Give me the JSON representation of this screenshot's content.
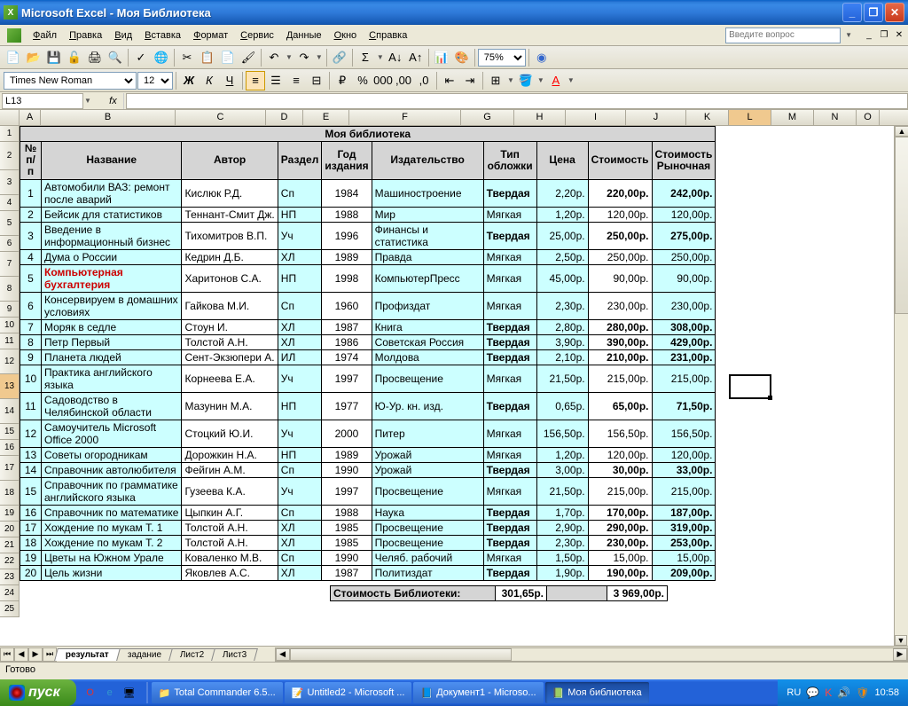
{
  "window": {
    "title": "Microsoft Excel - Моя Библиотека"
  },
  "menu": {
    "items": [
      "Файл",
      "Правка",
      "Вид",
      "Вставка",
      "Формат",
      "Сервис",
      "Данные",
      "Окно",
      "Справка"
    ],
    "question_placeholder": "Введите вопрос"
  },
  "toolbar2": {
    "font": "Times New Roman",
    "size": "12",
    "zoom": "75%"
  },
  "namebox": "L13",
  "cols": {
    "A": 24,
    "B": 152,
    "C": 102,
    "D": 42,
    "E": 52,
    "F": 126,
    "G": 60,
    "H": 58,
    "I": 68,
    "J": 68,
    "K": 48,
    "L": 48,
    "M": 48,
    "N": 48,
    "O": 26
  },
  "table": {
    "title": "Моя библиотека",
    "headers": [
      "№ п/п",
      "Название",
      "Автор",
      "Раздел",
      "Год издания",
      "Издательство",
      "Тип обложки",
      "Цена",
      "Стоимость",
      "Стоимость Рыночная"
    ],
    "rows": [
      {
        "n": "1",
        "name": "Автомобили ВАЗ: ремонт после аварий",
        "author": "Кислюк Р.Д.",
        "section": "Сп",
        "year": "1984",
        "pub": "Машиностроение",
        "cover": "Твердая",
        "price": "2,20р.",
        "cost": "220,00р.",
        "market": "242,00р.",
        "tall": true,
        "bold": true
      },
      {
        "n": "2",
        "name": "Бейсик для статистиков",
        "author": "Теннант-Смит Дж.",
        "section": "НП",
        "year": "1988",
        "pub": "Мир",
        "cover": "Мягкая",
        "price": "1,20р.",
        "cost": "120,00р.",
        "market": "120,00р."
      },
      {
        "n": "3",
        "name": "Введение в информационный бизнес",
        "author": "Тихомитров В.П.",
        "section": "Уч",
        "year": "1996",
        "pub": "Финансы и статистика",
        "cover": "Твердая",
        "price": "25,00р.",
        "cost": "250,00р.",
        "market": "275,00р.",
        "tall": true,
        "bold": true
      },
      {
        "n": "4",
        "name": "Дума о России",
        "author": "Кедрин Д.Б.",
        "section": "ХЛ",
        "year": "1989",
        "pub": "Правда",
        "cover": "Мягкая",
        "price": "2,50р.",
        "cost": "250,00р.",
        "market": "250,00р."
      },
      {
        "n": "5",
        "name": "Компьютерная бухгалтерия",
        "author": "Харитонов С.А.",
        "section": "НП",
        "year": "1998",
        "pub": "КомпьютерПресс",
        "cover": "Мягкая",
        "price": "45,00р.",
        "cost": "90,00р.",
        "market": "90,00р.",
        "tall": true,
        "red": true
      },
      {
        "n": "6",
        "name": "Консервируем в домашних условиях",
        "author": "Гайкова М.И.",
        "section": "Сп",
        "year": "1960",
        "pub": "Профиздат",
        "cover": "Мягкая",
        "price": "2,30р.",
        "cost": "230,00р.",
        "market": "230,00р.",
        "tall": true
      },
      {
        "n": "7",
        "name": "Моряк в седле",
        "author": "Стоун И.",
        "section": "ХЛ",
        "year": "1987",
        "pub": "Книга",
        "cover": "Твердая",
        "price": "2,80р.",
        "cost": "280,00р.",
        "market": "308,00р.",
        "bold": true
      },
      {
        "n": "8",
        "name": "Петр Первый",
        "author": "Толстой А.Н.",
        "section": "ХЛ",
        "year": "1986",
        "pub": "Советская Россия",
        "cover": "Твердая",
        "price": "3,90р.",
        "cost": "390,00р.",
        "market": "429,00р.",
        "bold": true
      },
      {
        "n": "9",
        "name": "Планета людей",
        "author": "Сент-Экзюпери А.",
        "section": "ИЛ",
        "year": "1974",
        "pub": "Молдова",
        "cover": "Твердая",
        "price": "2,10р.",
        "cost": "210,00р.",
        "market": "231,00р.",
        "bold": true
      },
      {
        "n": "10",
        "name": "Практика английского языка",
        "author": "Корнеева Е.А.",
        "section": "Уч",
        "year": "1997",
        "pub": "Просвещение",
        "cover": "Мягкая",
        "price": "21,50р.",
        "cost": "215,00р.",
        "market": "215,00р.",
        "tall": true
      },
      {
        "n": "11",
        "name": "Садоводство в Челябинской области",
        "author": "Мазунин М.А.",
        "section": "НП",
        "year": "1977",
        "pub": "Ю-Ур. кн. изд.",
        "cover": "Твердая",
        "price": "0,65р.",
        "cost": "65,00р.",
        "market": "71,50р.",
        "tall": true,
        "bold": true
      },
      {
        "n": "12",
        "name": "Самоучитель Microsoft Office 2000",
        "author": "Стоцкий Ю.И.",
        "section": "Уч",
        "year": "2000",
        "pub": "Питер",
        "cover": "Мягкая",
        "price": "156,50р.",
        "cost": "156,50р.",
        "market": "156,50р.",
        "tall": true
      },
      {
        "n": "13",
        "name": "Советы огородникам",
        "author": "Дорожкин Н.А.",
        "section": "НП",
        "year": "1989",
        "pub": "Урожай",
        "cover": "Мягкая",
        "price": "1,20р.",
        "cost": "120,00р.",
        "market": "120,00р."
      },
      {
        "n": "14",
        "name": "Справочник автолюбителя",
        "author": "Фейгин А.М.",
        "section": "Сп",
        "year": "1990",
        "pub": "Урожай",
        "cover": "Твердая",
        "price": "3,00р.",
        "cost": "30,00р.",
        "market": "33,00р.",
        "bold": true
      },
      {
        "n": "15",
        "name": "Справочник по грамматике английского языка",
        "author": "Гузеева К.А.",
        "section": "Уч",
        "year": "1997",
        "pub": "Просвещение",
        "cover": "Мягкая",
        "price": "21,50р.",
        "cost": "215,00р.",
        "market": "215,00р.",
        "tall": true
      },
      {
        "n": "16",
        "name": "Справочник по математике",
        "author": "Цыпкин А.Г.",
        "section": "Сп",
        "year": "1988",
        "pub": "Наука",
        "cover": "Твердая",
        "price": "1,70р.",
        "cost": "170,00р.",
        "market": "187,00р.",
        "bold": true
      },
      {
        "n": "17",
        "name": "Хождение по мукам Т. 1",
        "author": "Толстой А.Н.",
        "section": "ХЛ",
        "year": "1985",
        "pub": "Просвещение",
        "cover": "Твердая",
        "price": "2,90р.",
        "cost": "290,00р.",
        "market": "319,00р.",
        "bold": true
      },
      {
        "n": "18",
        "name": "Хождение по мукам Т. 2",
        "author": "Толстой А.Н.",
        "section": "ХЛ",
        "year": "1985",
        "pub": "Просвещение",
        "cover": "Твердая",
        "price": "2,30р.",
        "cost": "230,00р.",
        "market": "253,00р.",
        "bold": true
      },
      {
        "n": "19",
        "name": "Цветы на Южном Урале",
        "author": "Коваленко М.В.",
        "section": "Сп",
        "year": "1990",
        "pub": "Челяб. рабочий",
        "cover": "Мягкая",
        "price": "1,50р.",
        "cost": "15,00р.",
        "market": "15,00р."
      },
      {
        "n": "20",
        "name": "Цель жизни",
        "author": "Яковлев А.С.",
        "section": "ХЛ",
        "year": "1987",
        "pub": "Политиздат",
        "cover": "Твердая",
        "price": "1,90р.",
        "cost": "190,00р.",
        "market": "209,00р.",
        "bold": true
      }
    ],
    "summary": {
      "label": "Стоимость Библиотеки:",
      "total_price": "301,65р.",
      "total_market": "3 969,00р."
    }
  },
  "sheets": [
    "результат",
    "задание",
    "Лист2",
    "Лист3"
  ],
  "status": "Готово",
  "taskbar": {
    "start": "пуск",
    "tasks": [
      "Total Commander 6.5...",
      "Untitled2 - Microsoft ...",
      "Документ1 - Microso...",
      "Моя библиотека"
    ],
    "tray": {
      "lang": "RU",
      "time": "10:58"
    }
  },
  "selected_cell": "L13"
}
